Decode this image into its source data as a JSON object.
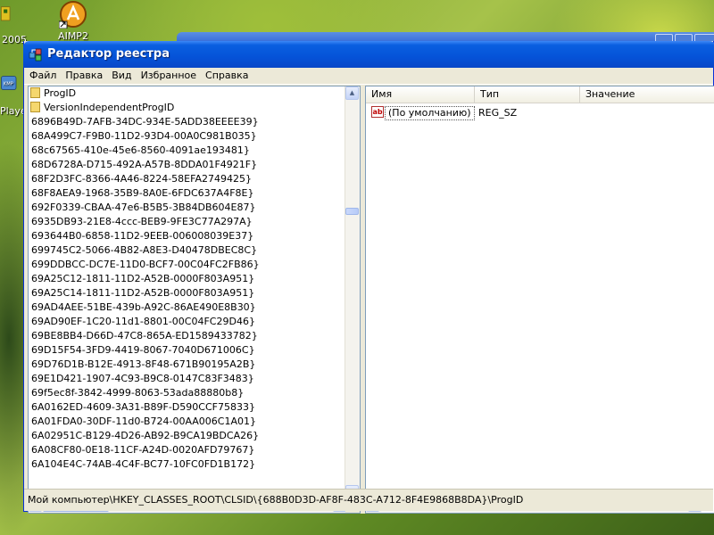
{
  "desktop": {
    "icons": [
      {
        "label": "2005"
      },
      {
        "label": "AIMP2"
      },
      {
        "label": "Player"
      }
    ]
  },
  "window": {
    "title": "Редактор реестра",
    "menu": [
      "Файл",
      "Правка",
      "Вид",
      "Избранное",
      "Справка"
    ]
  },
  "tree": {
    "folders": [
      "ProgID",
      "VersionIndependentProgID"
    ],
    "keys": [
      "6896B49D-7AFB-34DC-934E-5ADD38EEEE39}",
      "68A499C7-F9B0-11D2-93D4-00A0C981B035}",
      "68c67565-410e-45e6-8560-4091ae193481}",
      "68D6728A-D715-492A-A57B-8DDA01F4921F}",
      "68F2D3FC-8366-4A46-8224-58EFA2749425}",
      "68F8AEA9-1968-35B9-8A0E-6FDC637A4F8E}",
      "692F0339-CBAA-47e6-B5B5-3B84DB604E87}",
      "6935DB93-21E8-4ccc-BEB9-9FE3C77A297A}",
      "693644B0-6858-11D2-9EEB-006008039E37}",
      "699745C2-5066-4B82-A8E3-D40478DBEC8C}",
      "699DDBCC-DC7E-11D0-BCF7-00C04FC2FB86}",
      "69A25C12-1811-11D2-A52B-0000F803A951}",
      "69A25C14-1811-11D2-A52B-0000F803A951}",
      "69AD4AEE-51BE-439b-A92C-86AE490E8B30}",
      "69AD90EF-1C20-11d1-8801-00C04FC29D46}",
      "69BE8BB4-D66D-47C8-865A-ED1589433782}",
      "69D15F54-3FD9-4419-8067-7040D671006C}",
      "69D76D1B-B12E-4913-8F48-671B90195A2B}",
      "69E1D421-1907-4C93-B9C8-0147C83F3483}",
      "69f5ec8f-3842-4999-8063-53ada88880b8}",
      "6A0162ED-4609-3A31-B89F-D590CCF75833}",
      "6A01FDA0-30DF-11d0-B724-00AA006C1A01}",
      "6A02951C-B129-4D26-AB92-B9CA19BDCA26}",
      "6A08CF80-0E18-11CF-A24D-0020AFD79767}",
      "6A104E4C-74AB-4C4F-BC77-10FC0FD1B172}"
    ]
  },
  "list": {
    "columns": {
      "name": "Имя",
      "type": "Тип",
      "value": "Значение"
    },
    "rows": [
      {
        "icon": "ab",
        "name": "(По умолчанию)",
        "type": "REG_SZ",
        "value": ""
      }
    ]
  },
  "status": {
    "path": "Мой компьютер\\HKEY_CLASSES_ROOT\\CLSID\\{688B0D3D-AF8F-483C-A712-8F4E9868B8DA}\\ProgID"
  },
  "colors": {
    "titlebar": "#0a5fe0",
    "window_bg": "#ece9d8",
    "pane_border": "#7f9db9"
  }
}
